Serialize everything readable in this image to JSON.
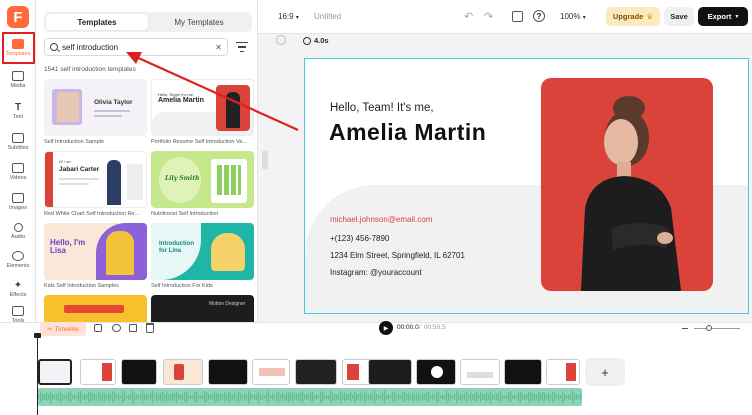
{
  "rail": {
    "items": [
      {
        "label": "Templates",
        "icon": "templates-icon"
      },
      {
        "label": "Media",
        "icon": "media-icon"
      },
      {
        "label": "Text",
        "icon": "text-icon"
      },
      {
        "label": "Subtitles",
        "icon": "subtitles-icon"
      },
      {
        "label": "Videos",
        "icon": "videos-icon"
      },
      {
        "label": "Images",
        "icon": "images-icon"
      },
      {
        "label": "Audio",
        "icon": "audio-icon"
      },
      {
        "label": "Elements",
        "icon": "elements-icon"
      },
      {
        "label": "Effects",
        "icon": "effects-icon"
      },
      {
        "label": "Tools",
        "icon": "tools-icon"
      }
    ],
    "logo": "F"
  },
  "panel": {
    "tabs": [
      "Templates",
      "My Templates"
    ],
    "search_value": "self introduction",
    "count_text": "1541 self introduction templates",
    "templates": [
      {
        "caption": "Self Introduction Sample",
        "name": "Olivia Taylor"
      },
      {
        "caption": "Portfolio Resume Self Introduction Ve...",
        "name": "Amelia Martin"
      },
      {
        "caption": "Red White Chart Self Introduction Re...",
        "name": "Jabari Carter"
      },
      {
        "caption": "Nutritionist Self Introduction",
        "name": "Lily Smith"
      },
      {
        "caption": "Kids Self Introduction Samples",
        "name": "Hello, I'm Lisa"
      },
      {
        "caption": "Self Introduction For Kids",
        "name": "Introduction for Lina"
      },
      {
        "caption": "",
        "name": ""
      },
      {
        "caption": "",
        "name": "Motion Designer"
      }
    ]
  },
  "topbar": {
    "ratio": "16:9",
    "title": "Untitled",
    "zoom": "100%",
    "upgrade": "Upgrade",
    "save": "Save",
    "export": "Export"
  },
  "canvas": {
    "duration": "4.0s",
    "greeting": "Hello, Team! It's me,",
    "name": "Amelia Martin",
    "email": "michael.johnson@email.com",
    "phone": "+(123) 456-7890",
    "address": "1234 Elm Street, Springfield, IL 62701",
    "instagram": "Instagram: @youraccount"
  },
  "timeline": {
    "label": "Timeline",
    "current_time": "00:00.0",
    "total_time": "00:50.5",
    "add": "+"
  },
  "colors": {
    "brand": "#ff6a3d",
    "accent_red": "#d9433a",
    "canvas_border": "#47c9e5",
    "annotation_red": "#e02020"
  }
}
